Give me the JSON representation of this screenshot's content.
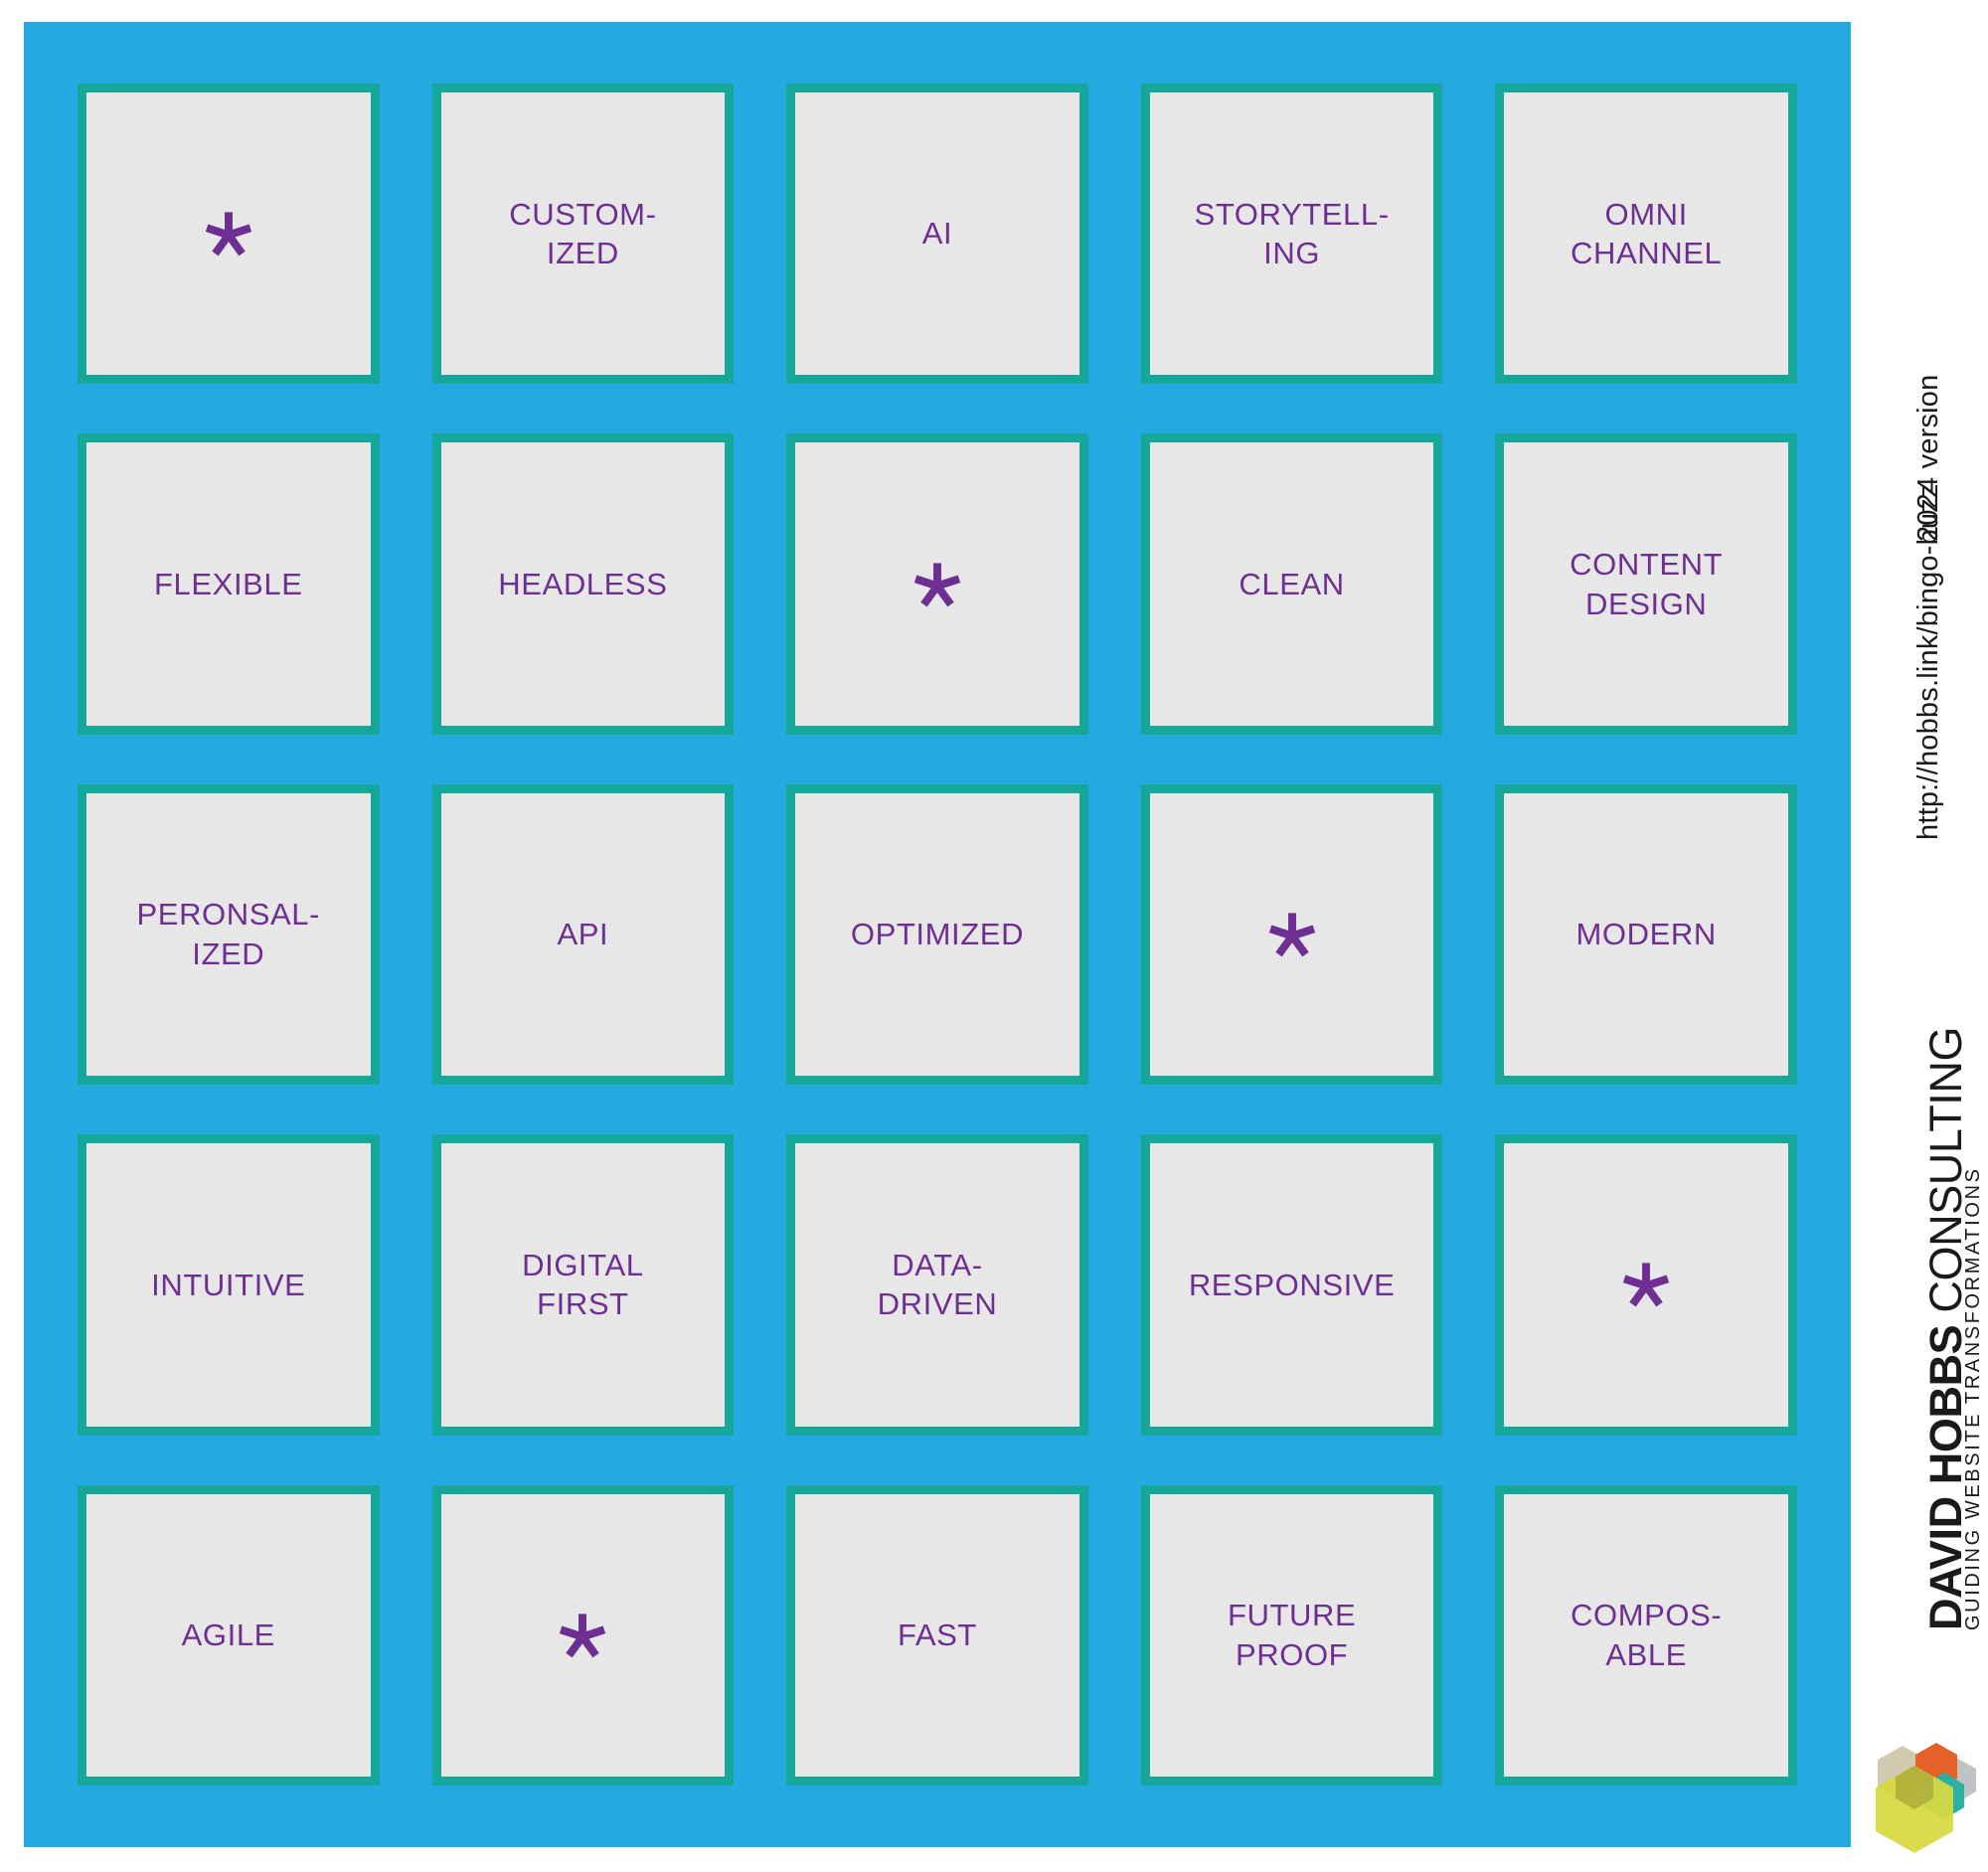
{
  "theme": {
    "panel_bg": "#25a9e0",
    "cell_fill": "#e7e7e7",
    "cell_border": "#15a89a",
    "text_purple": "#6d2f91",
    "page_bg": "#ffffff"
  },
  "bingo": {
    "rows": [
      [
        {
          "type": "free",
          "label": "*"
        },
        {
          "type": "label",
          "label": "CUSTOM-\nIZED"
        },
        {
          "type": "label",
          "label": "AI"
        },
        {
          "type": "label",
          "label": "STORYTELL-\nING"
        },
        {
          "type": "label",
          "label": "OMNI\nCHANNEL"
        }
      ],
      [
        {
          "type": "label",
          "label": "FLEXIBLE"
        },
        {
          "type": "label",
          "label": "HEADLESS"
        },
        {
          "type": "free",
          "label": "*"
        },
        {
          "type": "label",
          "label": "CLEAN"
        },
        {
          "type": "label",
          "label": "CONTENT\nDESIGN"
        }
      ],
      [
        {
          "type": "label",
          "label": "PERONSAL-\nIZED"
        },
        {
          "type": "label",
          "label": "API"
        },
        {
          "type": "label",
          "label": "OPTIMIZED"
        },
        {
          "type": "free",
          "label": "*"
        },
        {
          "type": "label",
          "label": "MODERN"
        }
      ],
      [
        {
          "type": "label",
          "label": "INTUITIVE"
        },
        {
          "type": "label",
          "label": "DIGITAL\nFIRST"
        },
        {
          "type": "label",
          "label": "DATA-\nDRIVEN"
        },
        {
          "type": "label",
          "label": "RESPONSIVE"
        },
        {
          "type": "free",
          "label": "*"
        }
      ],
      [
        {
          "type": "label",
          "label": "AGILE"
        },
        {
          "type": "free",
          "label": "*"
        },
        {
          "type": "label",
          "label": "FAST"
        },
        {
          "type": "label",
          "label": "FUTURE\nPROOF"
        },
        {
          "type": "label",
          "label": "COMPOS-\nABLE"
        }
      ]
    ]
  },
  "rail": {
    "url": "http://hobbs.link/bingo-buzz",
    "version": "2024 version",
    "brand_bold": "DAVID HOBBS",
    "brand_light": " CONSULTING",
    "tagline": "GUIDING WEBSITE TRANSFORMATIONS",
    "logo_name": "hexagon-cluster-logo",
    "logo_colors": {
      "big_hex": "#d8d93f",
      "orange_hex": "#e4622a",
      "teal_hex": "#2ab0a5",
      "tan_hex": "#cdc5a8",
      "gray_hex": "#b9bcbd",
      "olive_hex": "#a8a83a"
    }
  }
}
